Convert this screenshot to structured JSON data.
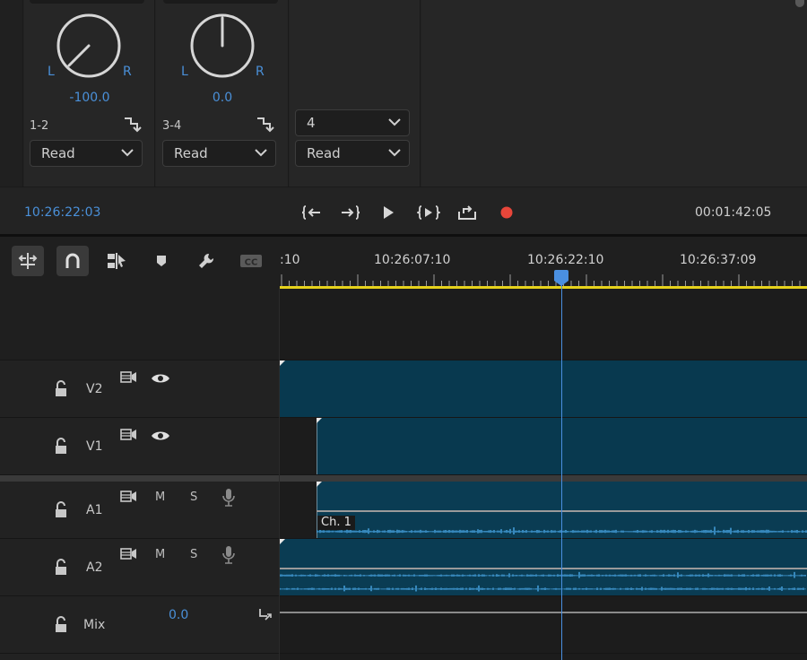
{
  "mixer": {
    "channels": [
      {
        "pan_value": "-100.0",
        "left_label": "L",
        "right_label": "R",
        "track_label": "1-2",
        "automation": "Read"
      },
      {
        "pan_value": "0.0",
        "left_label": "L",
        "right_label": "R",
        "track_label": "3-4",
        "automation": "Read"
      },
      {
        "track_select": "4",
        "automation": "Read"
      }
    ]
  },
  "transport": {
    "current_timecode": "10:26:22:03",
    "duration": "00:01:42:05"
  },
  "timeline": {
    "ruler_labels": [
      ":10",
      "10:26:07:10",
      "10:26:22:10",
      "10:26:37:09"
    ],
    "tracks": [
      {
        "name": "V2",
        "type": "video"
      },
      {
        "name": "V1",
        "type": "video"
      },
      {
        "name": "A1",
        "type": "audio",
        "mute": "M",
        "solo": "S"
      },
      {
        "name": "A2",
        "type": "audio",
        "mute": "M",
        "solo": "S"
      },
      {
        "name": "Mix",
        "type": "mix",
        "value": "0.0"
      }
    ],
    "clip_label": "Ch. 1"
  },
  "colors": {
    "accent": "#4a90d9",
    "clip": "#08394f",
    "waveform": "#4aa8e8",
    "ruler_bar": "#e6d21c",
    "record": "#e8463a"
  }
}
